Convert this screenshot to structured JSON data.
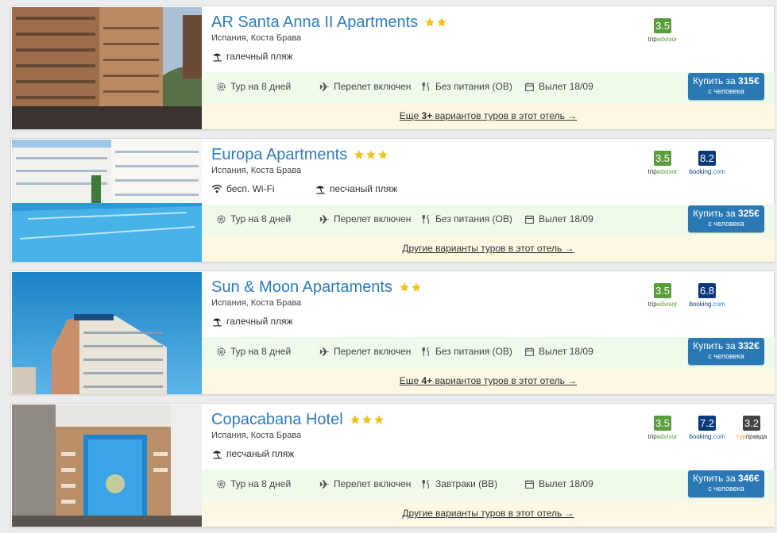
{
  "common": {
    "buy_prefix": "Купить за",
    "per_person": "с человека"
  },
  "hotels": [
    {
      "name": "AR Santa Anna II Apartments",
      "stars": 2,
      "location": "Испания, Коста Брава",
      "features": [
        {
          "icon": "beach-umbrella-icon",
          "label": "галечный пляж"
        }
      ],
      "ratings": [
        {
          "source": "tripadvisor",
          "score": "3.5",
          "label_a": "trip",
          "label_b": "advisor"
        }
      ],
      "tour": "Тур на 8 дней",
      "flight": "Перелет включен",
      "meals": "Без питания (OB)",
      "departure": "Вылет 18/09",
      "price": "315€",
      "more": {
        "pre": "Еще ",
        "bold": "3+",
        "post": " вариантов туров в этот отель →"
      }
    },
    {
      "name": "Europa Apartments",
      "stars": 3,
      "location": "Испания, Коста Брава",
      "features": [
        {
          "icon": "wifi-icon",
          "label": "бесп. Wi-Fi"
        },
        {
          "icon": "beach-umbrella-icon",
          "label": "песчаный пляж"
        }
      ],
      "ratings": [
        {
          "source": "tripadvisor",
          "score": "3.5",
          "label_a": "trip",
          "label_b": "advisor"
        },
        {
          "source": "booking",
          "score": "8.2",
          "label_a": "booking",
          "label_b": ".com"
        }
      ],
      "tour": "Тур на 8 дней",
      "flight": "Перелет включен",
      "meals": "Без питания (OB)",
      "departure": "Вылет 18/09",
      "price": "325€",
      "more": {
        "pre": "Другие варианты туров в этот отель →",
        "bold": "",
        "post": ""
      }
    },
    {
      "name": "Sun & Moon Apartaments",
      "stars": 2,
      "location": "Испания, Коста Брава",
      "features": [
        {
          "icon": "beach-umbrella-icon",
          "label": "галечный пляж"
        }
      ],
      "ratings": [
        {
          "source": "tripadvisor",
          "score": "3.5",
          "label_a": "trip",
          "label_b": "advisor"
        },
        {
          "source": "booking",
          "score": "6.8",
          "label_a": "booking",
          "label_b": ".com"
        }
      ],
      "tour": "Тур на 8 дней",
      "flight": "Перелет включен",
      "meals": "Без питания (OB)",
      "departure": "Вылет 18/09",
      "price": "332€",
      "more": {
        "pre": "Еще ",
        "bold": "4+",
        "post": " вариантов туров в этот отель →"
      }
    },
    {
      "name": "Copacabana Hotel",
      "stars": 3,
      "location": "Испания, Коста Брава",
      "features": [
        {
          "icon": "beach-umbrella-icon",
          "label": "песчаный пляж"
        }
      ],
      "ratings": [
        {
          "source": "tripadvisor",
          "score": "3.5",
          "label_a": "trip",
          "label_b": "advisor"
        },
        {
          "source": "booking",
          "score": "7.2",
          "label_a": "booking",
          "label_b": ".com"
        },
        {
          "source": "turpravda",
          "score": "3.2",
          "label_a": "тур",
          "label_b": "правда"
        }
      ],
      "tour": "Тур на 8 дней",
      "flight": "Перелет включен",
      "meals": "Завтраки (BB)",
      "departure": "Вылет 18/09",
      "price": "346€",
      "more": {
        "pre": "Другие варианты туров в этот отель →",
        "bold": "",
        "post": ""
      }
    }
  ],
  "colors": {
    "link": "#2b7dc0",
    "star": "#f2c11a",
    "tripadvisor": "#5a9d3b",
    "booking": "#0a3a7d",
    "turpravda": "#444444",
    "info_band": "#effaea",
    "more_band": "#fcf8e3",
    "button": "#2a79b5"
  }
}
